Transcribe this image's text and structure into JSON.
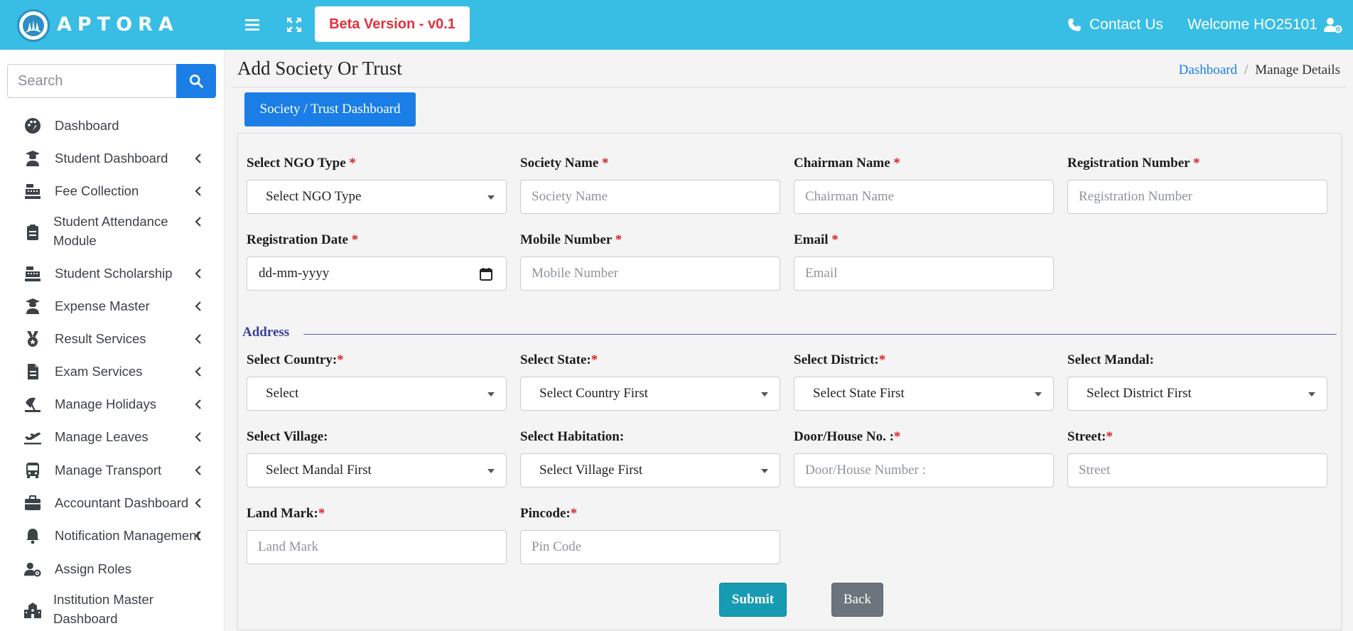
{
  "header": {
    "brand": "APTORA",
    "beta_label": "Beta Version - v0.1",
    "contact_label": "Contact Us",
    "welcome_label": "Welcome HO25101",
    "color": "#38bde5"
  },
  "sidebar": {
    "search_placeholder": "Search",
    "items": [
      {
        "label": "Dashboard",
        "icon": "palette-icon",
        "chevron": false
      },
      {
        "label": "Student Dashboard",
        "icon": "graduate-icon",
        "chevron": true
      },
      {
        "label": "Fee Collection",
        "icon": "cash-register-icon",
        "chevron": true
      },
      {
        "label": "Student Attendance",
        "label2": "Module",
        "icon": "clipboard-icon",
        "chevron": true
      },
      {
        "label": "Student Scholarship",
        "icon": "cash-register-icon",
        "chevron": true
      },
      {
        "label": "Expense Master",
        "icon": "graduate-icon",
        "chevron": true
      },
      {
        "label": "Result Services",
        "icon": "medal-icon",
        "chevron": true
      },
      {
        "label": "Exam Services",
        "icon": "document-icon",
        "chevron": true
      },
      {
        "label": "Manage Holidays",
        "icon": "umbrella-beach-icon",
        "chevron": true
      },
      {
        "label": "Manage Leaves",
        "icon": "plane-departure-icon",
        "chevron": true
      },
      {
        "label": "Manage Transport",
        "icon": "bus-icon",
        "chevron": true
      },
      {
        "label": "Accountant Dashboard",
        "icon": "briefcase-icon",
        "chevron": true
      },
      {
        "label": "Notification Management",
        "icon": "bell-icon",
        "chevron": true
      },
      {
        "label": "Assign Roles",
        "icon": "user-gear-icon",
        "chevron": false
      },
      {
        "label": "Institution Master",
        "label2": "Dashboard",
        "icon": "school-icon",
        "chevron": false
      }
    ]
  },
  "main": {
    "title": "Add Society Or Trust",
    "breadcrumb": {
      "link": "Dashboard",
      "separator": "/",
      "current": "Manage Details"
    },
    "dashboard_button": "Society / Trust Dashboard",
    "fields": {
      "ngo_type": {
        "label": "Select NGO Type",
        "value": "Select NGO Type"
      },
      "society_name": {
        "label": "Society Name",
        "placeholder": "Society Name"
      },
      "chairman_name": {
        "label": "Chairman Name",
        "placeholder": "Chairman Name"
      },
      "registration_number": {
        "label": "Registration Number",
        "placeholder": "Registration Number"
      },
      "registration_date": {
        "label": "Registration Date",
        "value": "dd-mm-yyyy"
      },
      "mobile_number": {
        "label": "Mobile Number",
        "placeholder": "Mobile Number"
      },
      "email": {
        "label": "Email",
        "placeholder": "Email"
      }
    },
    "address": {
      "legend": "Address",
      "country": {
        "label": "Select Country:",
        "value": "Select"
      },
      "state": {
        "label": "Select State:",
        "value": "Select Country First"
      },
      "district": {
        "label": "Select District:",
        "value": "Select State First"
      },
      "mandal": {
        "label": "Select Mandal:",
        "value": "Select District First"
      },
      "village": {
        "label": "Select Village:",
        "value": "Select Mandal First"
      },
      "habitation": {
        "label": "Select Habitation:",
        "value": "Select Village First"
      },
      "door": {
        "label": "Door/House No. :",
        "placeholder": "Door/House Number :"
      },
      "street": {
        "label": "Street:",
        "placeholder": "Street"
      },
      "landmark": {
        "label": "Land Mark:",
        "placeholder": "Land Mark"
      },
      "pincode": {
        "label": "Pincode:",
        "placeholder": "Pin Code"
      }
    },
    "submit_label": "Submit",
    "back_label": "Back",
    "required_mark": "*"
  }
}
